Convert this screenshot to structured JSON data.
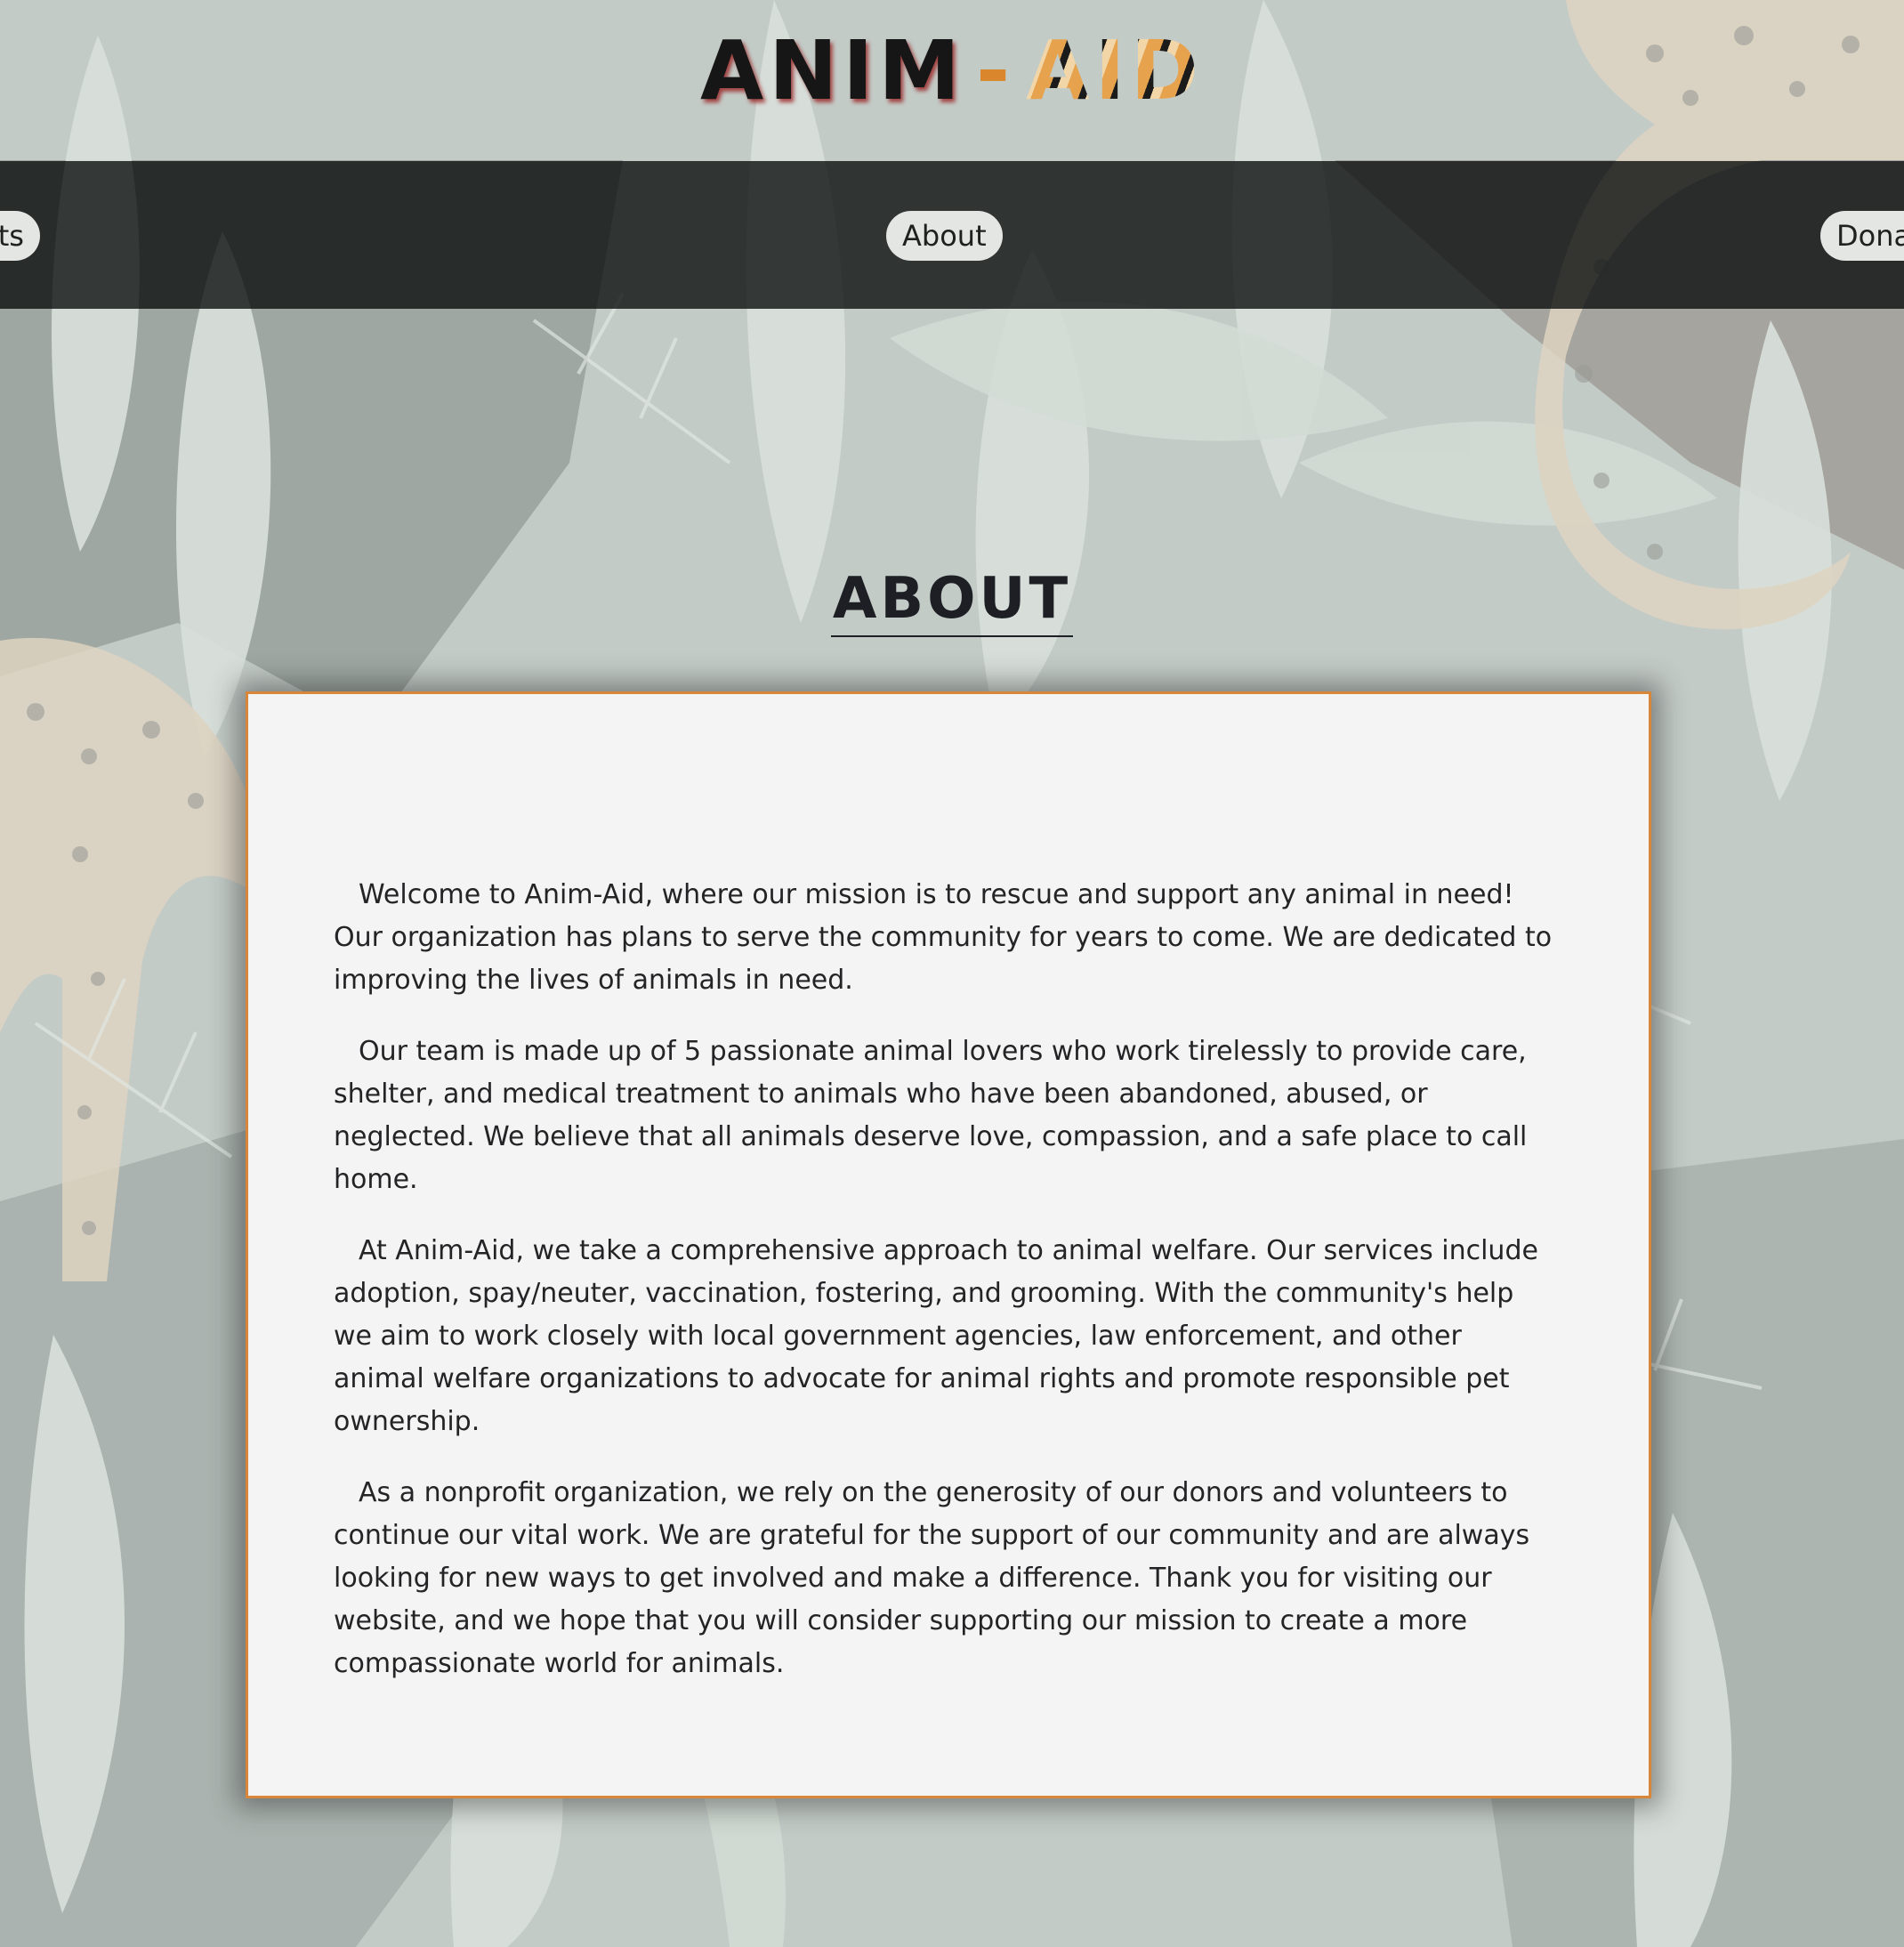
{
  "header": {
    "logo_part1": "ANIM",
    "logo_dash": "-",
    "logo_part2": "AID"
  },
  "nav": {
    "items": [
      {
        "label": "ets",
        "note": "partially cut off at left edge"
      },
      {
        "label": "About",
        "active": true
      },
      {
        "label": "Dona",
        "note": "partially cut off at right edge"
      }
    ]
  },
  "about": {
    "title": "ABOUT",
    "paragraphs": [
      "Welcome to Anim-Aid, where our mission is to rescue and support any animal in need! Our organization has plans to serve the community for years to come. We are dedicated to improving the lives of animals in need.",
      "Our team is made up of 5 passionate animal lovers who work tirelessly to provide care, shelter, and medical treatment to animals who have been abandoned, abused, or neglected. We believe that all animals deserve love, compassion, and a safe place to call home.",
      "At Anim-Aid, we take a comprehensive approach to animal welfare. Our services include adoption, spay/neuter, vaccination, fostering, and grooming. With the community's help we aim to work closely with local government agencies, law enforcement, and other animal welfare organizations to advocate for animal rights and promote responsible pet ownership.",
      "As a nonprofit organization, we rely on the generosity of our donors and volunteers to continue our vital work. We are grateful for the support of our community and are always looking for new ways to get involved and make a difference. Thank you for visiting our website, and we hope that you will consider supporting our mission to create a more compassionate world for animals."
    ]
  },
  "colors": {
    "card_border": "#d8873a",
    "navbar": "#060a0a",
    "pill": "#e3e6e3",
    "text": "#242426"
  }
}
